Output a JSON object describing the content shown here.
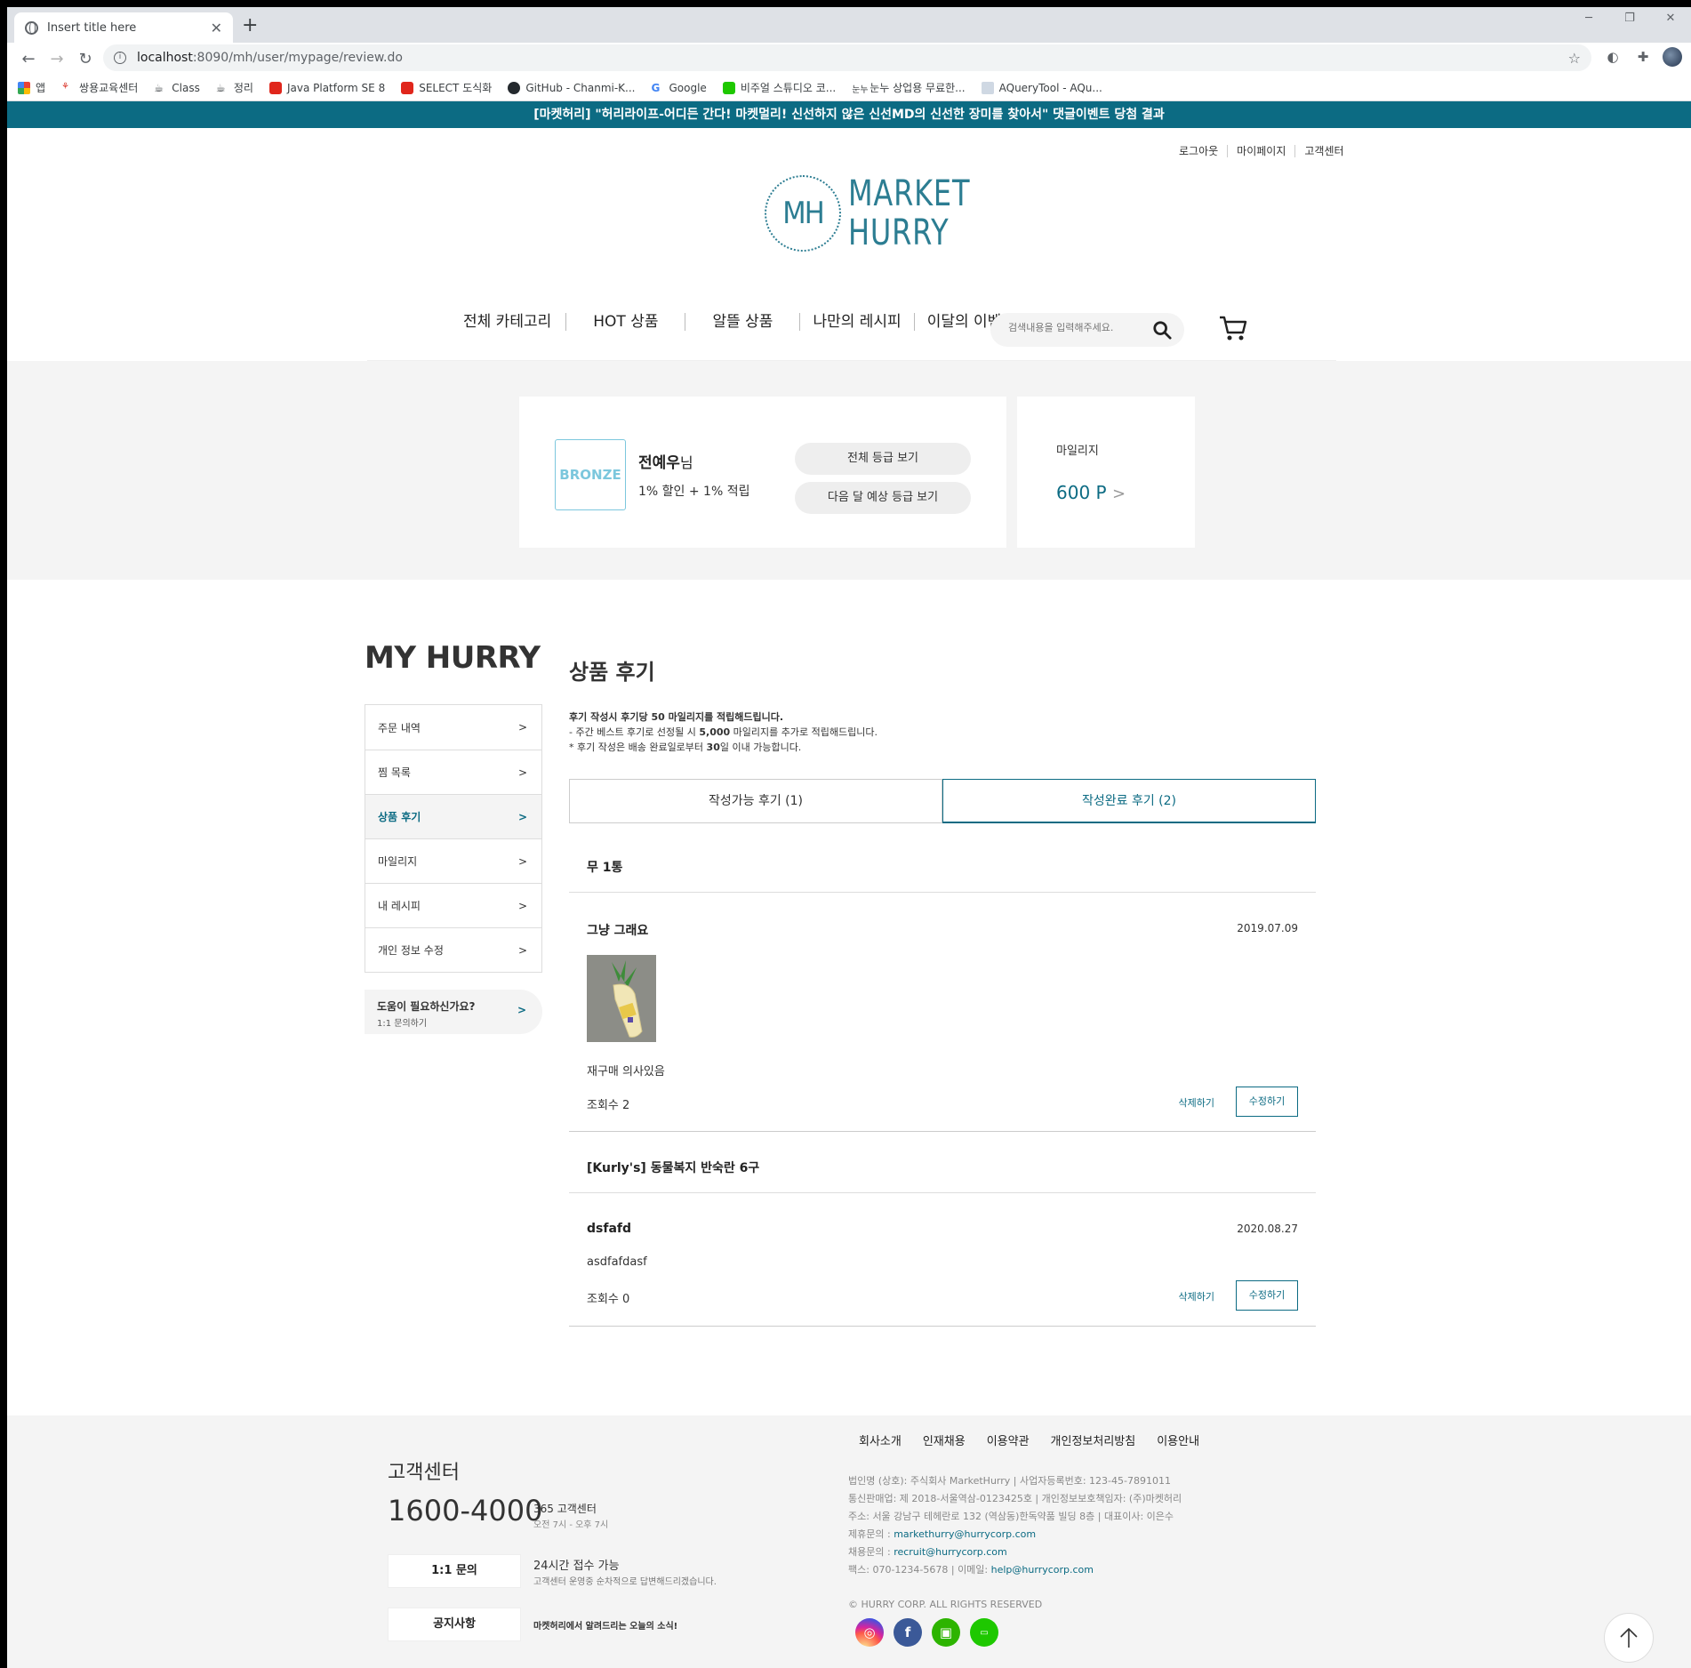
{
  "browser": {
    "tab_title": "Insert title here",
    "new_tab": "+",
    "url_host": "localhost",
    "url_path": ":8090/mh/user/mypage/review.do",
    "bookmarks": [
      "앱",
      "쌍용교육센터",
      "Class",
      "정리",
      "Java Platform SE 8",
      "SELECT 도식화",
      "GitHub - Chanmi-K...",
      "Google",
      "비주얼 스튜디오 코...",
      "눈누 상업용 무료한...",
      "AQueryTool - AQu..."
    ]
  },
  "banner": "[마켓허리] \"허리라이프-어디든 간다! 마켓멀리! 신선하지 않은 신선MD의 신선한 장미를 찾아서\" 댓글이벤트 당첨 결과",
  "util_nav": [
    "로그아웃",
    "마이페이지",
    "고객센터"
  ],
  "logo": {
    "mark": "MH",
    "line1": "MARKET",
    "line2": "HURRY"
  },
  "gnb": [
    "전체 카테고리",
    "HOT 상품",
    "알뜰 상품",
    "나만의 레시피",
    "이달의 이벤트"
  ],
  "search": {
    "placeholder": "검색내용을 입력해주세요."
  },
  "grade": {
    "badge": "BRONZE",
    "name": "전예우",
    "suffix": "님",
    "benefit": "1% 할인 + 1% 적립",
    "btn_all": "전체 등급 보기",
    "btn_next": "다음 달 예상 등급 보기"
  },
  "mileage": {
    "label": "마일리지",
    "value": "600 P",
    "arrow": ">"
  },
  "side": {
    "title": "MY HURRY",
    "items": [
      {
        "label": "주문 내역",
        "arrow": ">"
      },
      {
        "label": "찜 목록",
        "arrow": ">"
      },
      {
        "label": "상품 후기",
        "arrow": ">"
      },
      {
        "label": "마일리지",
        "arrow": ">"
      },
      {
        "label": "내 레시피",
        "arrow": ">"
      },
      {
        "label": "개인 정보 수정",
        "arrow": ">"
      }
    ],
    "help_title": "도움이 필요하신가요?",
    "help_sub": "1:1 문의하기",
    "help_arrow": ">"
  },
  "content": {
    "title": "상품 후기",
    "notice_bold": "후기 작성시 후기당 50 마일리지를 적립해드립니다.",
    "notice_2a": "- 주간 베스트 후기로 선정될 시 ",
    "notice_2b": "5,000",
    "notice_2c": " 마일리지를 추가로 적립해드립니다.",
    "notice_3a": "* 후기 작성은 배송 완료일로부터 ",
    "notice_3b": "30",
    "notice_3c": "일 이내 가능합니다.",
    "tab_writable": "작성가능 후기 (1)",
    "tab_done": "작성완료 후기 (2)"
  },
  "reviews": [
    {
      "product": "무 1통",
      "title": "그냥 그래요",
      "date": "2019.07.09",
      "text": "재구매 의사있음",
      "views": "조회수 2",
      "delete": "삭제하기",
      "edit": "수정하기"
    },
    {
      "product": "[Kurly's] 동물복지 반숙란 6구",
      "title": "dsfafd",
      "date": "2020.08.27",
      "text": "asdfafdasf",
      "views": "조회수 0",
      "delete": "삭제하기",
      "edit": "수정하기"
    }
  ],
  "footer": {
    "cs_title": "고객센터",
    "tel": "1600-4000",
    "hours_title": "365 고객센터",
    "hours": "오전 7시 - 오후 7시",
    "btn_qna": "1:1 문의",
    "qna_title": "24시간 접수 가능",
    "qna_desc": "고객센터 운영중 순차적으로 답변해드리겠습니다.",
    "btn_notice": "공지사항",
    "notice_desc": "마켓허리에서 알려드리는 오늘의 소식!",
    "links": [
      "회사소개",
      "인재채용",
      "이용약관",
      "개인정보처리방침",
      "이용안내"
    ],
    "info1": "법인명 (상호): 주식회사 MarketHurry  |  사업자등록번호: 123-45-7891011",
    "info2": "통신판매업: 제 2018-서울역삼-0123425호  |  개인정보보호책임자: (주)마켓허리",
    "info3": "주소: 서울 강남구 테헤란로 132 (역삼동)한독약품 빌딩 8층  |  대표이사: 이은수",
    "info4_label": "제휴문의 : ",
    "info4_link": "markethurry@hurrycorp.com",
    "info5_label": "채용문의 : ",
    "info5_link": "recruit@hurrycorp.com",
    "info6_label": "팩스: 070-1234-5678  |  이메일: ",
    "info6_link": "help@hurrycorp.com",
    "copyright": "© HURRY CORP. ALL RIGHTS RESERVED"
  },
  "colors": {
    "brand": "#0c6b83",
    "badge": "#7cc7dd"
  }
}
